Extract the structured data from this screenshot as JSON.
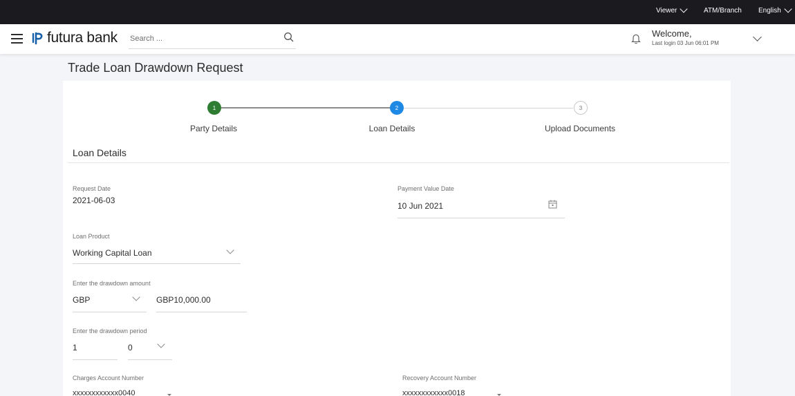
{
  "topbar": {
    "viewer": "Viewer",
    "atm_branch": "ATM/Branch",
    "language": "English"
  },
  "header": {
    "logo_text": "futura bank",
    "search_placeholder": "Search ...",
    "welcome": "Welcome,",
    "last_login": "Last login 03 Jun 06:01 PM"
  },
  "page": {
    "title": "Trade Loan Drawdown Request"
  },
  "stepper": {
    "steps": [
      {
        "number": "1",
        "label": "Party Details",
        "state": "completed"
      },
      {
        "number": "2",
        "label": "Loan Details",
        "state": "active"
      },
      {
        "number": "3",
        "label": "Upload Documents",
        "state": "pending"
      }
    ]
  },
  "form": {
    "section_title": "Loan Details",
    "request_date_label": "Request Date",
    "request_date_value": "2021-06-03",
    "payment_value_date_label": "Payment Value Date",
    "payment_value_date_value": "10 Jun 2021",
    "loan_product_label": "Loan Product",
    "loan_product_value": "Working Capital Loan",
    "drawdown_amount_label": "Enter the drawdown amount",
    "currency_value": "GBP",
    "amount_value": "GBP10,000.00",
    "drawdown_period_label": "Enter the drawdown period",
    "period_first_value": "1",
    "period_second_value": "0",
    "charges_account_label": "Charges Account Number",
    "charges_account_value": "xxxxxxxxxxxx0040",
    "recovery_account_label": "Recovery Account Number",
    "recovery_account_value": "xxxxxxxxxxxx0018"
  },
  "colors": {
    "step_completed": "#2e7d32",
    "step_active": "#1e88e5",
    "topbar_bg": "#1a1a1f",
    "logo_accent": "#1560a8"
  }
}
